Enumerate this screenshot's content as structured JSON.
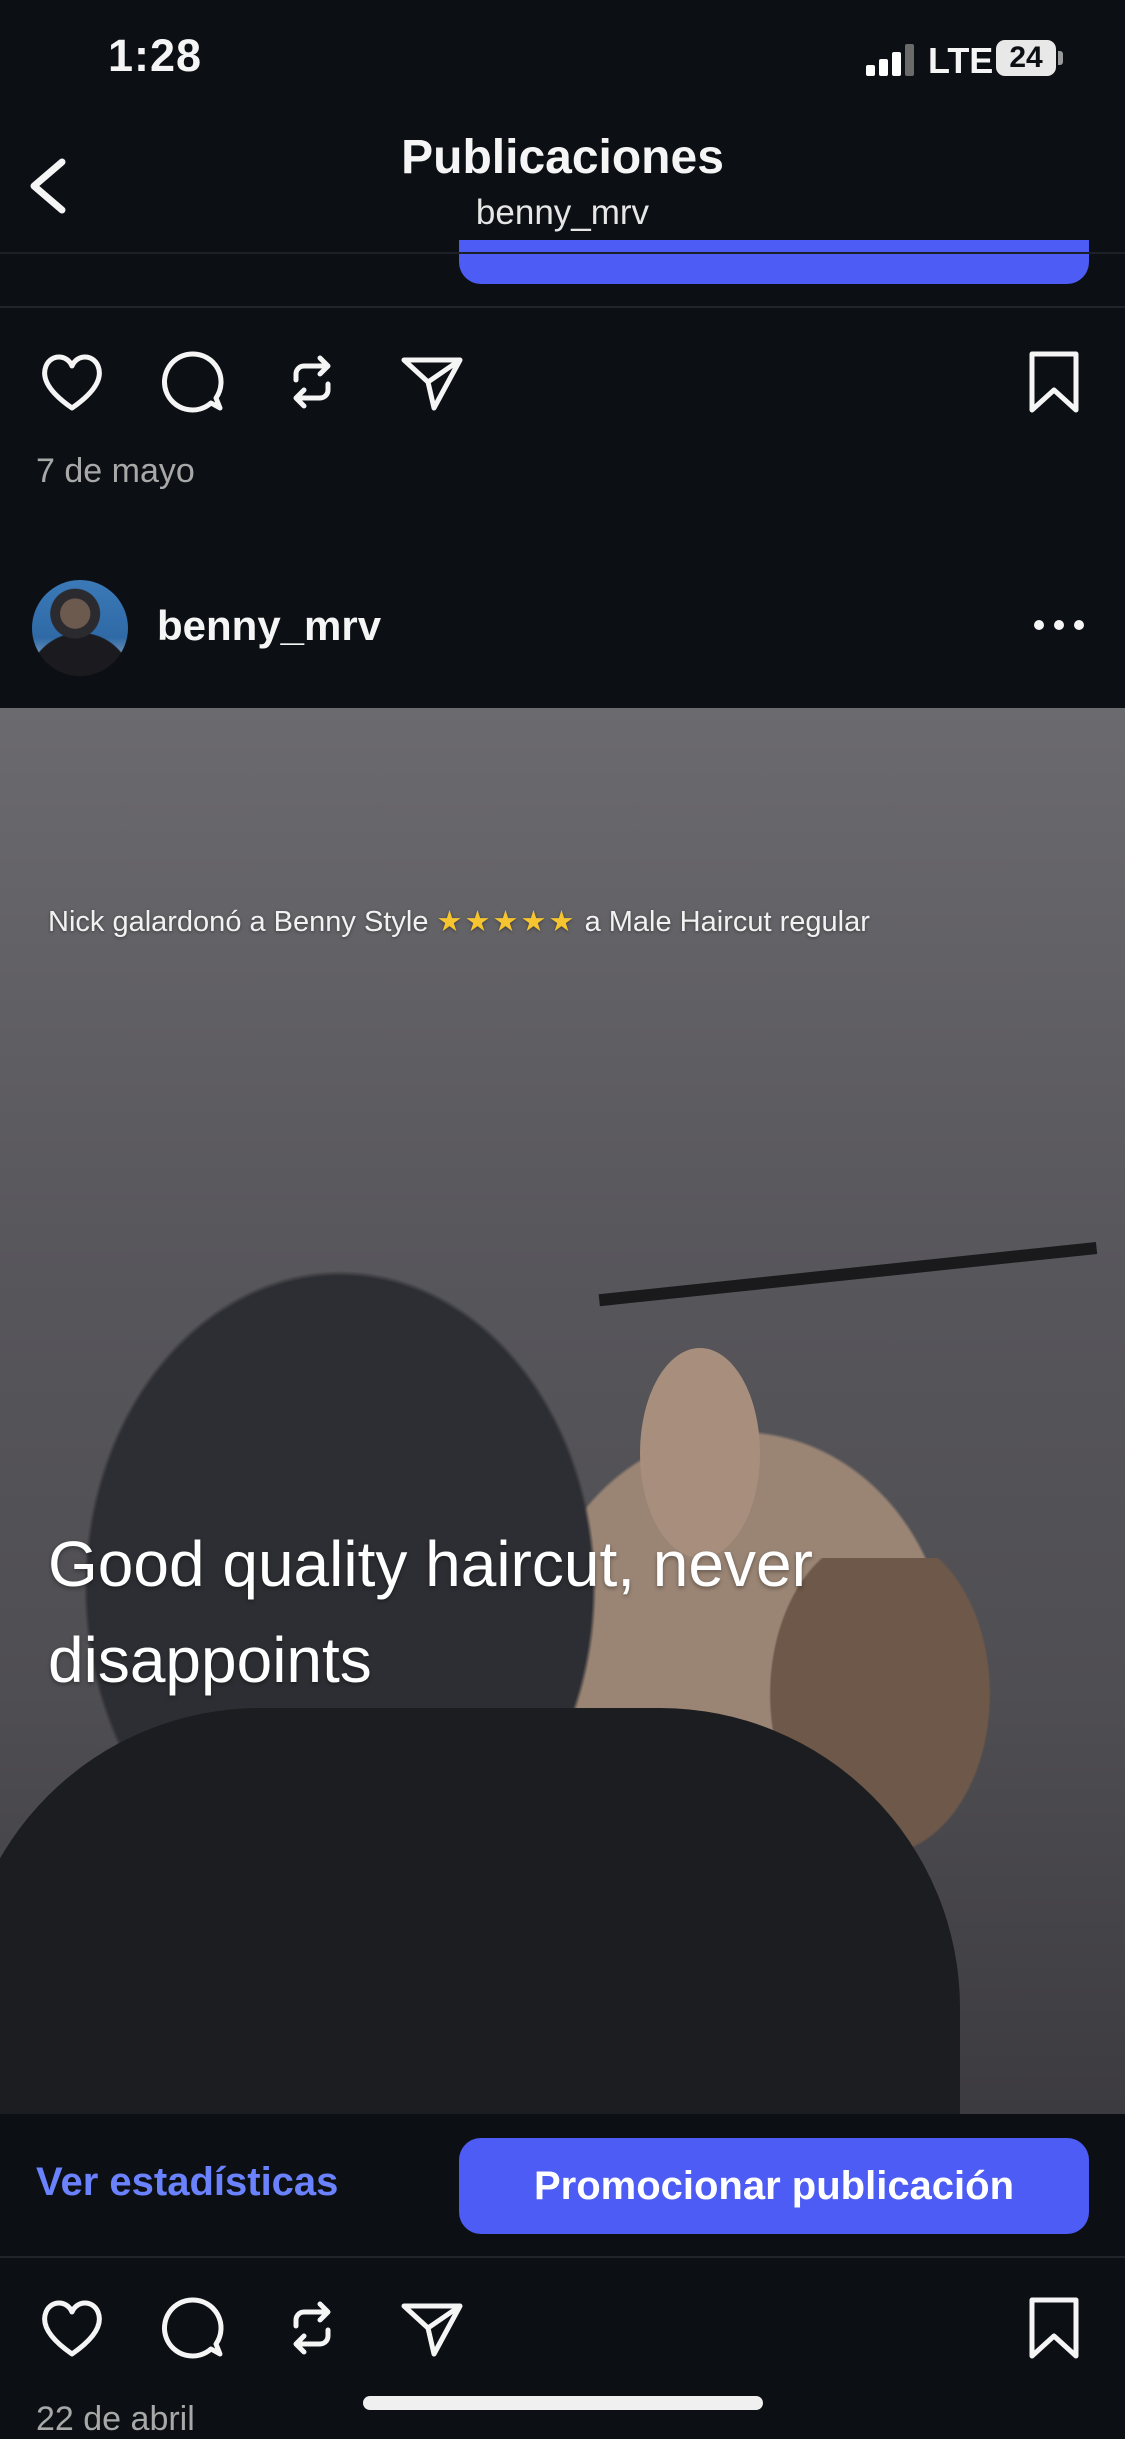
{
  "status_bar": {
    "time": "1:28",
    "network": "LTE",
    "battery": "24"
  },
  "header": {
    "title": "Publicaciones",
    "subtitle": "benny_mrv"
  },
  "posts": [
    {
      "date": "7 de mayo"
    },
    {
      "username": "benny_mrv",
      "image": {
        "review_prefix": "Nick galardonó a Benny Style",
        "stars": "★★★★★",
        "review_suffix": "a Male Haircut regular",
        "review_text": "Good quality haircut, never disappoints"
      },
      "stats_link": "Ver estadísticas",
      "promote_button": "Promocionar publicación",
      "date": "22 de abril"
    }
  ],
  "colors": {
    "background": "#0c1014",
    "accent": "#4d5cf4",
    "link": "#6b82ff"
  }
}
